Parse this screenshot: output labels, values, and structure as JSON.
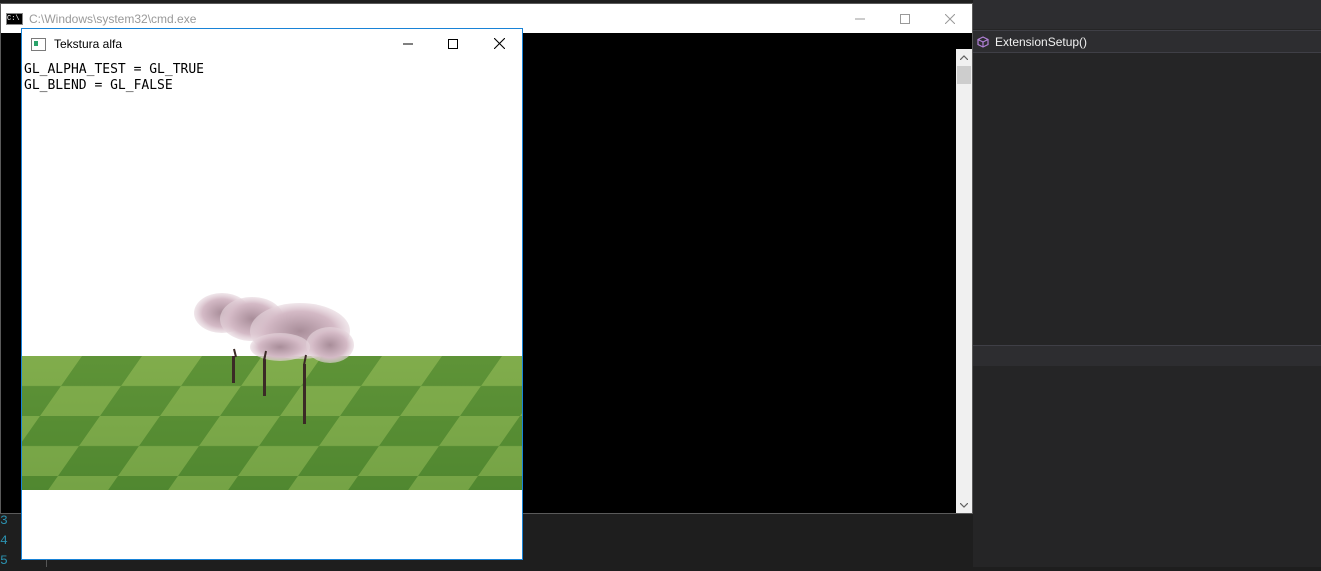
{
  "cmd_window": {
    "title": "C:\\Windows\\system32\\cmd.exe",
    "icon_text": "C:\\"
  },
  "gl_window": {
    "title": "Tekstura alfa",
    "lines": [
      "GL_ALPHA_TEST = GL_TRUE",
      "GL_BLEND = GL_FALSE"
    ]
  },
  "ide": {
    "function_label": "ExtensionSetup()",
    "line_numbers": [
      "3",
      "4",
      "5"
    ]
  },
  "colors": {
    "grass_light": "#7fa948",
    "grass_dark": "#4f8530",
    "blossom": "#cdb0bd",
    "trunk": "#3b2a26",
    "accent": "#1883d7"
  }
}
